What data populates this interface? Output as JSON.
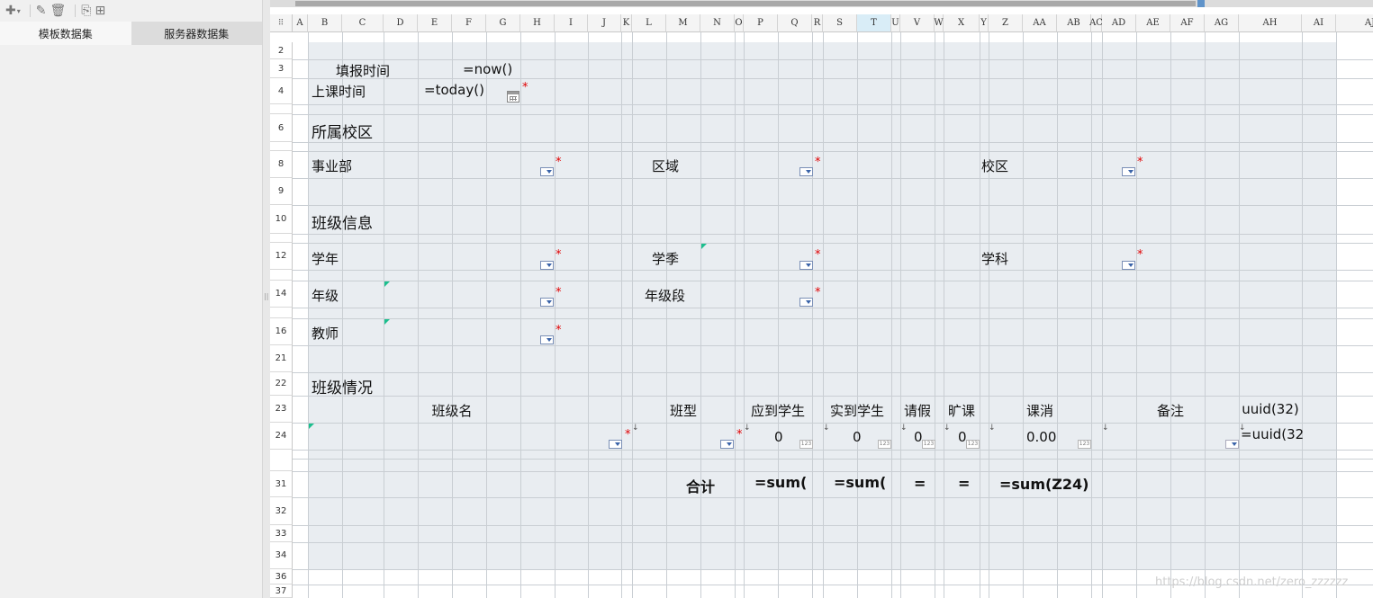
{
  "left_panel": {
    "toolbar_icons": [
      "add-icon",
      "edit-icon",
      "delete-icon",
      "preview-icon",
      "chart-icon"
    ],
    "tabs": [
      {
        "label": "模板数据集",
        "active": true
      },
      {
        "label": "服务器数据集",
        "active": false
      }
    ]
  },
  "sheet": {
    "columns": [
      "A",
      "B",
      "C",
      "D",
      "E",
      "F",
      "G",
      "H",
      "I",
      "J",
      "K",
      "L",
      "M",
      "N",
      "O",
      "P",
      "Q",
      "R",
      "S",
      "T",
      "U",
      "V",
      "W",
      "X",
      "Y",
      "Z",
      "AA",
      "AB",
      "AC",
      "AD",
      "AE",
      "AF",
      "AG",
      "AH",
      "AI",
      "AJ"
    ],
    "selected_column": "T",
    "rows": [
      "2",
      "3",
      "4",
      "6",
      "8",
      "9",
      "10",
      "12",
      "14",
      "16",
      "21",
      "22",
      "23",
      "24",
      "31",
      "32",
      "33",
      "34",
      "36",
      "37"
    ],
    "labels": {
      "fill_time": "填报时间",
      "fill_time_formula": "=now()",
      "class_time": "上课时间",
      "class_time_formula": "=today()",
      "campus_section": "所属校区",
      "division": "事业部",
      "region": "区域",
      "campus": "校区",
      "class_info_section": "班级信息",
      "school_year": "学年",
      "season": "学季",
      "subject": "学科",
      "grade": "年级",
      "grade_level": "年级段",
      "teacher": "教师",
      "class_status_section": "班级情况",
      "total": "合计"
    },
    "table_headers": [
      "班级名",
      "班型",
      "应到学生",
      "实到学生",
      "请假",
      "旷课",
      "课消",
      "备注",
      "uuid(32)"
    ],
    "table_row24": {
      "expected": "0",
      "actual": "0",
      "leave": "0",
      "absent": "0",
      "consumption": "0.00",
      "uuid_formula": "=uuid(32"
    },
    "totals_row31": {
      "expected_sum": "=sum(",
      "actual_sum": "=sum(",
      "leave_sum": "=",
      "absent_sum": "=",
      "consumption_sum": "=sum(Z24)"
    },
    "required_mark": "*",
    "number_icon_text": "123"
  },
  "watermark": "https://blog.csdn.net/zero_zzzzzz",
  "colors": {
    "panel_bg": "#f0f0f0",
    "sheet_fill": "#e9edf1",
    "gridline": "#c9ced3",
    "required": "#e00000",
    "selected_col": "#d9edf7",
    "scroll_marker": "#5f93c9"
  }
}
